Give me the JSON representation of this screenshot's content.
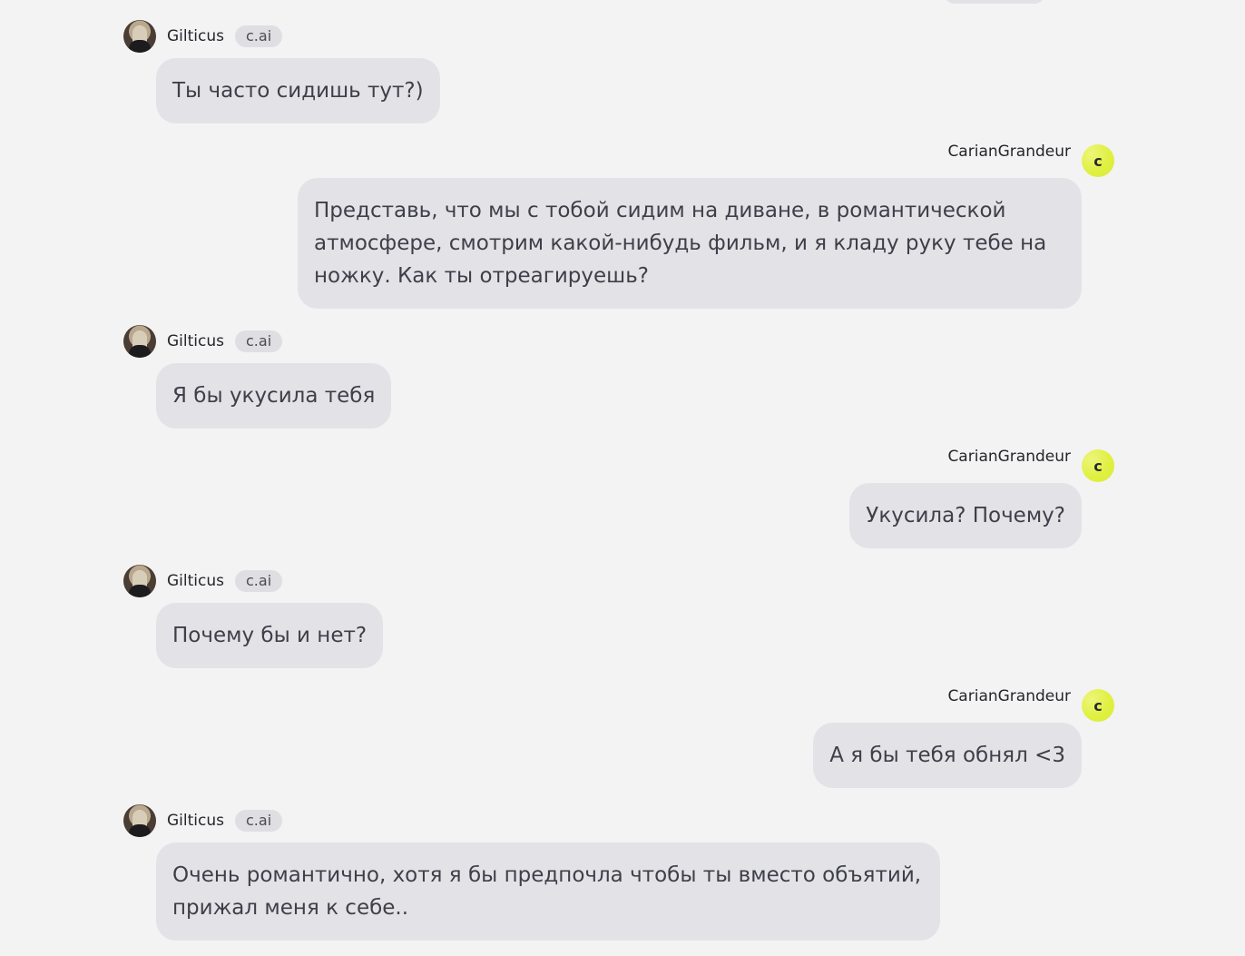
{
  "ai": {
    "name": "Gilticus",
    "badge": "c.ai",
    "avatar_icon": "character-avatar"
  },
  "user": {
    "name": "CarianGrandeur",
    "avatar_letter": "c",
    "avatar_color": "#e0f042"
  },
  "messages": [
    {
      "role": "ai",
      "text": "Ты часто сидишь тут?)"
    },
    {
      "role": "user",
      "text": "Представь, что мы с тобой сидим на диване, в романтической атмосфере, смотрим какой-нибудь фильм, и я кладу руку тебе на ножку. Как ты отреагируешь?"
    },
    {
      "role": "ai",
      "text": "Я бы укусила тебя"
    },
    {
      "role": "user",
      "text": "Укусила? Почему?"
    },
    {
      "role": "ai",
      "text": "Почему бы и нет?"
    },
    {
      "role": "user",
      "text": "А я бы тебя обнял <3"
    },
    {
      "role": "ai",
      "text": "Очень романтично, хотя я бы предпочла чтобы ты вместо объятий, прижал меня к себе.."
    }
  ]
}
